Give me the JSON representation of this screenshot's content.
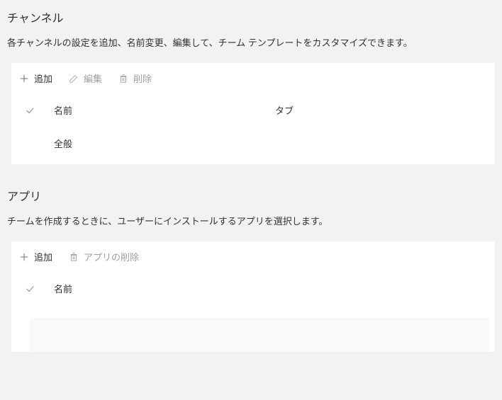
{
  "channels": {
    "title": "チャンネル",
    "description": "各チャンネルの設定を追加、名前変更、編集して、チーム テンプレートをカスタマイズできます。",
    "toolbar": {
      "add": "追加",
      "edit": "編集",
      "delete": "削除"
    },
    "columns": {
      "name": "名前",
      "tab": "タブ"
    },
    "rows": [
      {
        "name": "全般",
        "tab": ""
      }
    ]
  },
  "apps": {
    "title": "アプリ",
    "description": "チームを作成するときに、ユーザーにインストールするアプリを選択します。",
    "toolbar": {
      "add": "追加",
      "delete": "アプリの削除"
    },
    "columns": {
      "name": "名前"
    }
  }
}
